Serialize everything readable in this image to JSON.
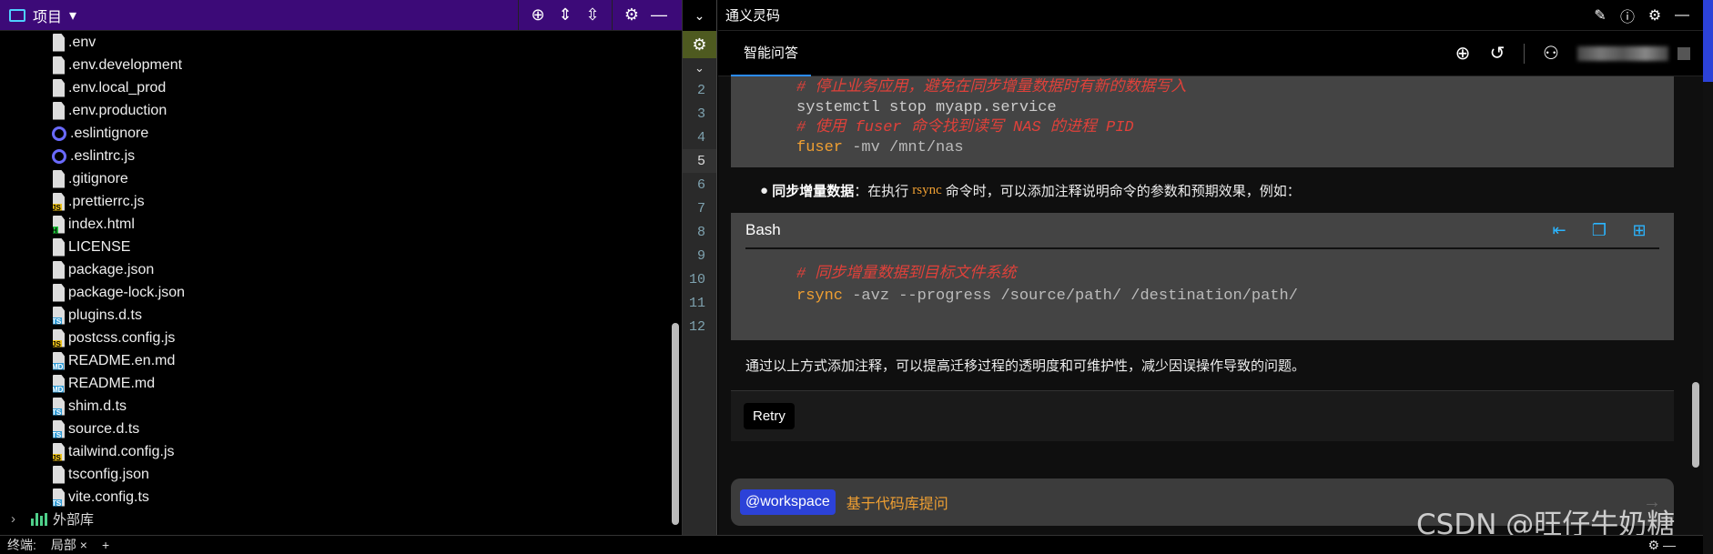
{
  "project": {
    "title": "项目",
    "files": [
      {
        "name": ".env",
        "icon": "file-icon"
      },
      {
        "name": ".env.development",
        "icon": "file-icon"
      },
      {
        "name": ".env.local_prod",
        "icon": "file-icon"
      },
      {
        "name": ".env.production",
        "icon": "file-icon"
      },
      {
        "name": ".eslintignore",
        "icon": "eslint-icon"
      },
      {
        "name": ".eslintrc.js",
        "icon": "eslint-icon"
      },
      {
        "name": ".gitignore",
        "icon": "file-icon"
      },
      {
        "name": ".prettierrc.js",
        "icon": "js-file-icon",
        "tag": "JS"
      },
      {
        "name": "index.html",
        "icon": "html-file-icon",
        "tag": "H"
      },
      {
        "name": "LICENSE",
        "icon": "file-icon"
      },
      {
        "name": "package.json",
        "icon": "json-file-icon"
      },
      {
        "name": "package-lock.json",
        "icon": "json-file-icon"
      },
      {
        "name": "plugins.d.ts",
        "icon": "ts-file-icon",
        "tag": "TS"
      },
      {
        "name": "postcss.config.js",
        "icon": "js-file-icon",
        "tag": "JS"
      },
      {
        "name": "README.en.md",
        "icon": "md-file-icon",
        "tag": "MD"
      },
      {
        "name": "README.md",
        "icon": "md-file-icon",
        "tag": "MD"
      },
      {
        "name": "shim.d.ts",
        "icon": "ts-file-icon",
        "tag": "TS"
      },
      {
        "name": "source.d.ts",
        "icon": "ts-file-icon",
        "tag": "TS"
      },
      {
        "name": "tailwind.config.js",
        "icon": "js-file-icon",
        "tag": "JS"
      },
      {
        "name": "tsconfig.json",
        "icon": "json-file-icon"
      },
      {
        "name": "vite.config.ts",
        "icon": "ts-file-icon",
        "tag": "TS"
      }
    ],
    "external_libs": "外部库"
  },
  "gutter": {
    "line_numbers": [
      "2",
      "3",
      "4",
      "5",
      "6",
      "7",
      "8",
      "9",
      "10",
      "11",
      "12"
    ],
    "current_line": "5"
  },
  "chat": {
    "window_title": "通义灵码",
    "active_tab": "智能问答",
    "code_block_1": {
      "lines": [
        {
          "kind": "comment",
          "text": "# 停止业务应用，避免在同步增量数据时有新的数据写入"
        },
        {
          "kind": "code",
          "cmd": "systemctl stop myapp.service",
          "args": ""
        },
        {
          "kind": "comment",
          "text": "# 使用 fuser 命令找到读写 NAS 的进程 PID"
        },
        {
          "kind": "code",
          "cmd": "fuser",
          "args": " -mv /mnt/nas"
        }
      ]
    },
    "bullet": {
      "bold": "同步增量数据",
      "before": "：在执行",
      "code": "rsync",
      "after": "命令时，可以添加注释说明命令的参数和预期效果，例如："
    },
    "bash_block": {
      "lang": "Bash",
      "comment": "# 同步增量数据到目标文件系统",
      "cmd": "rsync",
      "args": " -avz --progress /source/path/ /destination/path/"
    },
    "summary": "通过以上方式添加注释，可以提高迁移过程的透明度和可维护性，减少因误操作导致的问题。",
    "retry_label": "Retry",
    "input": {
      "mention": "@workspace",
      "placeholder": "基于代码库提问"
    }
  },
  "bottom_bar": {
    "terminal_label": "终端:",
    "tab_label": "局部",
    "close": "×",
    "add": "+"
  },
  "watermark": "CSDN @旺仔牛奶糖",
  "colors": {
    "project_header": "#3c0a78",
    "accent_blue": "#2c42d8",
    "comment_red": "#e0413a",
    "command_orange": "#ef9f32"
  }
}
